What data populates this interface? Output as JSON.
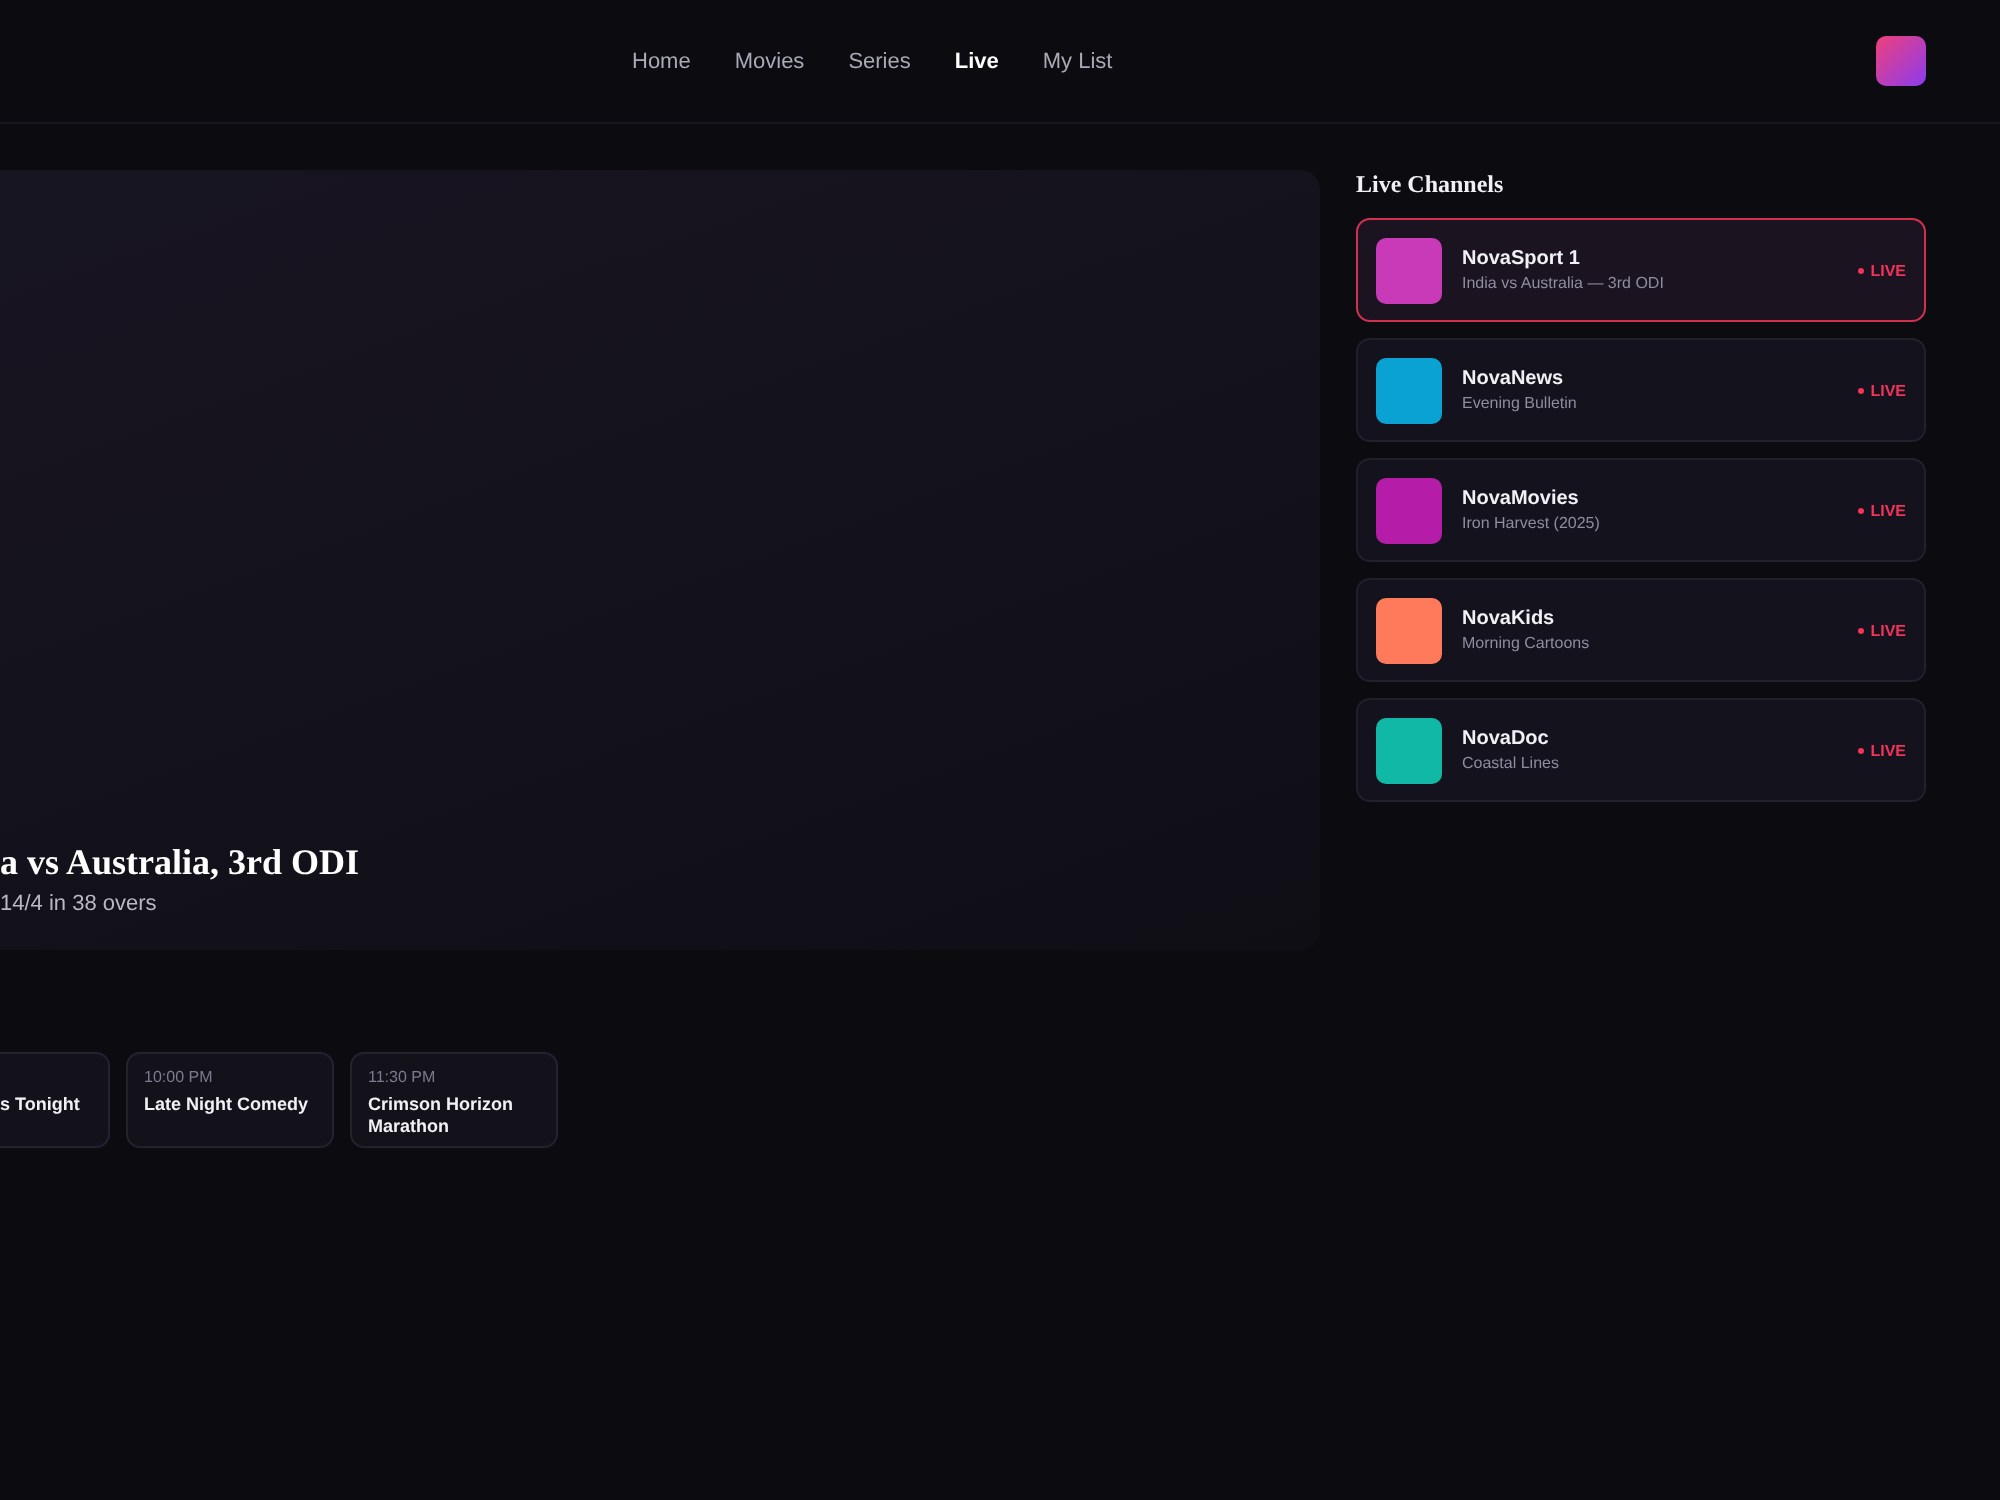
{
  "nav": [
    {
      "label": "Home",
      "selected": false
    },
    {
      "label": "Movies",
      "selected": false
    },
    {
      "label": "Series",
      "selected": false
    },
    {
      "label": "Live",
      "selected": true
    },
    {
      "label": "My List",
      "selected": false
    }
  ],
  "player": {
    "title": "a vs Australia, 3rd ODI",
    "subtitle": "14/4 in 38 overs"
  },
  "schedule": [
    {
      "title": "s Tonight"
    },
    {
      "time": "10:00 PM",
      "title": "Late Night Comedy"
    },
    {
      "time": "11:30 PM",
      "title": "Crimson Horizon Marathon"
    }
  ],
  "live_channels": {
    "heading": "Live Channels",
    "channels": [
      {
        "name": "NovaSport 1",
        "program": "India vs Australia — 3rd ODI",
        "badge": "LIVE",
        "selected": true,
        "color": "#c93ab8"
      },
      {
        "name": "NovaNews",
        "program": "Evening Bulletin",
        "badge": "LIVE",
        "selected": false,
        "color": "#0aa2d2"
      },
      {
        "name": "NovaMovies",
        "program": "Iron Harvest (2025)",
        "badge": "LIVE",
        "selected": false,
        "color": "#b51ca8"
      },
      {
        "name": "NovaKids",
        "program": "Morning Cartoons",
        "badge": "LIVE",
        "selected": false,
        "color": "#ff7a5a"
      },
      {
        "name": "NovaDoc",
        "program": "Coastal Lines",
        "badge": "LIVE",
        "selected": false,
        "color": "#12b8a6"
      }
    ]
  }
}
